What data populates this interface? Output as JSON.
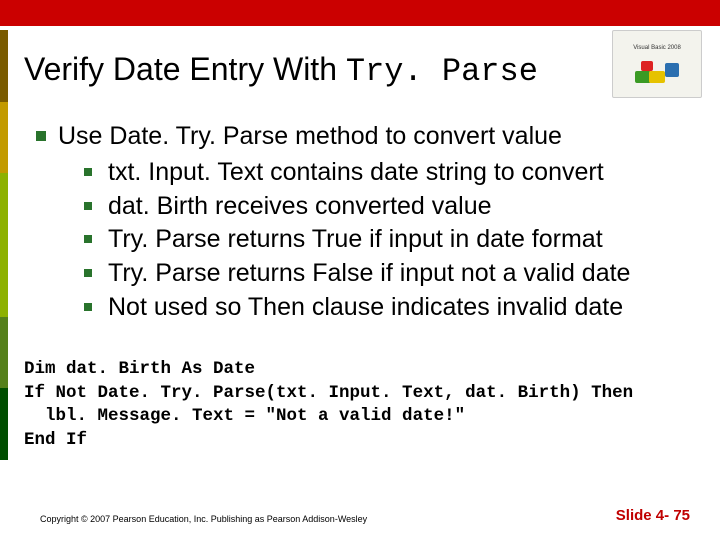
{
  "title_plain": "Verify Date Entry With ",
  "title_mono": "Try. Parse",
  "corner_label": "Visual Basic 2008",
  "bullets": {
    "main": "Use Date. Try. Parse method to convert value",
    "subs": [
      "txt. Input. Text contains date string to convert",
      "dat. Birth receives converted value",
      "Try. Parse returns True if input in date format",
      "Try. Parse returns False if input not a valid date",
      "Not used so Then clause indicates invalid date"
    ]
  },
  "code_lines": [
    "Dim dat. Birth As Date",
    "If Not Date. Try. Parse(txt. Input. Text, dat. Birth) Then",
    "  lbl. Message. Text = \"Not a valid date!\"",
    "End If"
  ],
  "copyright": "Copyright © 2007 Pearson Education, Inc. Publishing as Pearson Addison-Wesley",
  "slidenum": "Slide 4- 75"
}
